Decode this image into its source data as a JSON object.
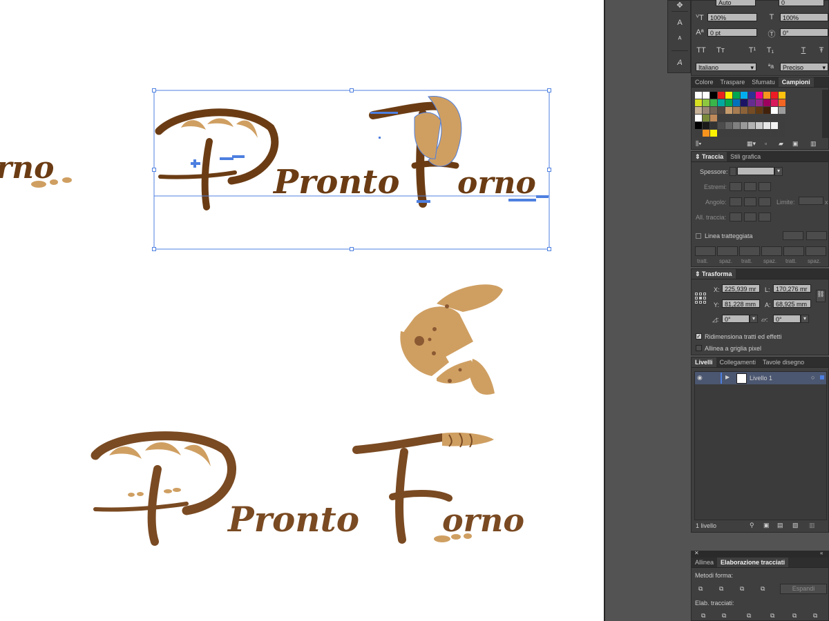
{
  "canvas": {
    "logo_word_primary": "Pronto",
    "logo_word_secondary": "Forno",
    "partial_text": "rno",
    "colors": {
      "brown_dark": "#6b3c14",
      "brown": "#7a4a22",
      "tan": "#cf9f62",
      "selection": "#4d7fe0"
    }
  },
  "character_panel": {
    "vscale": "100%",
    "hscale": "100%",
    "baseline": "0 pt",
    "rotation": "0°",
    "language": "Italiano",
    "antialias": "Preciso",
    "glyphs": {
      "tt": "TT",
      "tsmall": "Tт",
      "tsup": "T¹",
      "tsub": "T₁",
      "under": "T",
      "strike": "Ŧ"
    }
  },
  "swatches_panel": {
    "tabs": [
      "Colore",
      "Traspare",
      "Sfumatu",
      "Campioni"
    ],
    "active_tab": "Campioni",
    "rows": [
      [
        "#ffffff",
        "#ffffff",
        "#000000",
        "#e8231f",
        "#fff200",
        "#00a651",
        "#00aeef",
        "#2e3192",
        "#ec008c",
        "#f7941d",
        "#ed1c24",
        "#ffc20e"
      ],
      [
        "#d7df23",
        "#8dc63f",
        "#39b54a",
        "#00a99d",
        "#00a651",
        "#0072bc",
        "#1b1464",
        "#662d91",
        "#92278f",
        "#9e005d",
        "#d91b5c",
        "#f26522"
      ],
      [
        "#c7b299",
        "#998675",
        "#736357",
        "#534741",
        "#c69c6d",
        "#a67c52",
        "#8c6239",
        "#754c24",
        "#603913",
        "#42210b",
        "#ffffff",
        "#9c9c9c"
      ],
      [
        "#ffffff",
        "#7a8a3a",
        "#c08a5a",
        "#3e3e3e",
        "#3e3e3e",
        "#3e3e3e",
        "#3e3e3e",
        "#3e3e3e",
        "#3e3e3e",
        "#3e3e3e",
        "#3e3e3e",
        "#3e3e3e"
      ],
      [
        "#000000",
        "#1a1a1a",
        "#333333",
        "#4d4d4d",
        "#666666",
        "#808080",
        "#999999",
        "#b3b3b3",
        "#cccccc",
        "#e6e6e6",
        "#f2f2f2",
        "#3e3e3e"
      ],
      [
        "#3e3e3e",
        "#f7941d",
        "#fff200",
        "#3e3e3e",
        "#3e3e3e",
        "#3e3e3e",
        "#3e3e3e",
        "#3e3e3e",
        "#3e3e3e",
        "#3e3e3e",
        "#3e3e3e",
        "#3e3e3e"
      ]
    ]
  },
  "stroke_panel": {
    "tabs": [
      "Traccia",
      "Stili grafica"
    ],
    "spessore_label": "Spessore:",
    "estremi_label": "Estremi:",
    "angolo_label": "Angolo:",
    "limite_label": "Limite:",
    "limite_unit": "x",
    "allinea_label": "All. traccia:",
    "dashed_label": "Linea tratteggiata",
    "dash_labels": [
      "tratt.",
      "spaz.",
      "tratt.",
      "spaz.",
      "tratt.",
      "spaz."
    ]
  },
  "transform_panel": {
    "title": "Trasforma",
    "x_label": "X:",
    "x_value": "225,939 mr",
    "y_label": "Y:",
    "y_value": "81,228 mm",
    "w_label": "L:",
    "w_value": "170,276 mr",
    "h_label": "A:",
    "h_value": "68,925 mm",
    "angle_value": "0°",
    "shear_value": "0°",
    "scale_strokes_label": "Ridimensiona tratti ed effetti",
    "scale_strokes_checked": true,
    "snap_grid_label": "Allinea a griglia pixel",
    "snap_grid_checked": false
  },
  "layers_panel": {
    "tabs": [
      "Livelli",
      "Collegamenti",
      "Tavole disegno"
    ],
    "layer_name": "Livello 1",
    "count": "1 livello"
  },
  "pathfinder_panel": {
    "tabs": [
      "Allinea",
      "Elaborazione tracciati"
    ],
    "shape_modes_label": "Metodi forma:",
    "expand_label": "Espandi",
    "pathfinders_label": "Elab. tracciati:"
  },
  "tools": {
    "icons": [
      "touch-type-icon",
      "area-type-icon",
      "path-type-icon",
      "glyph-icon"
    ]
  }
}
